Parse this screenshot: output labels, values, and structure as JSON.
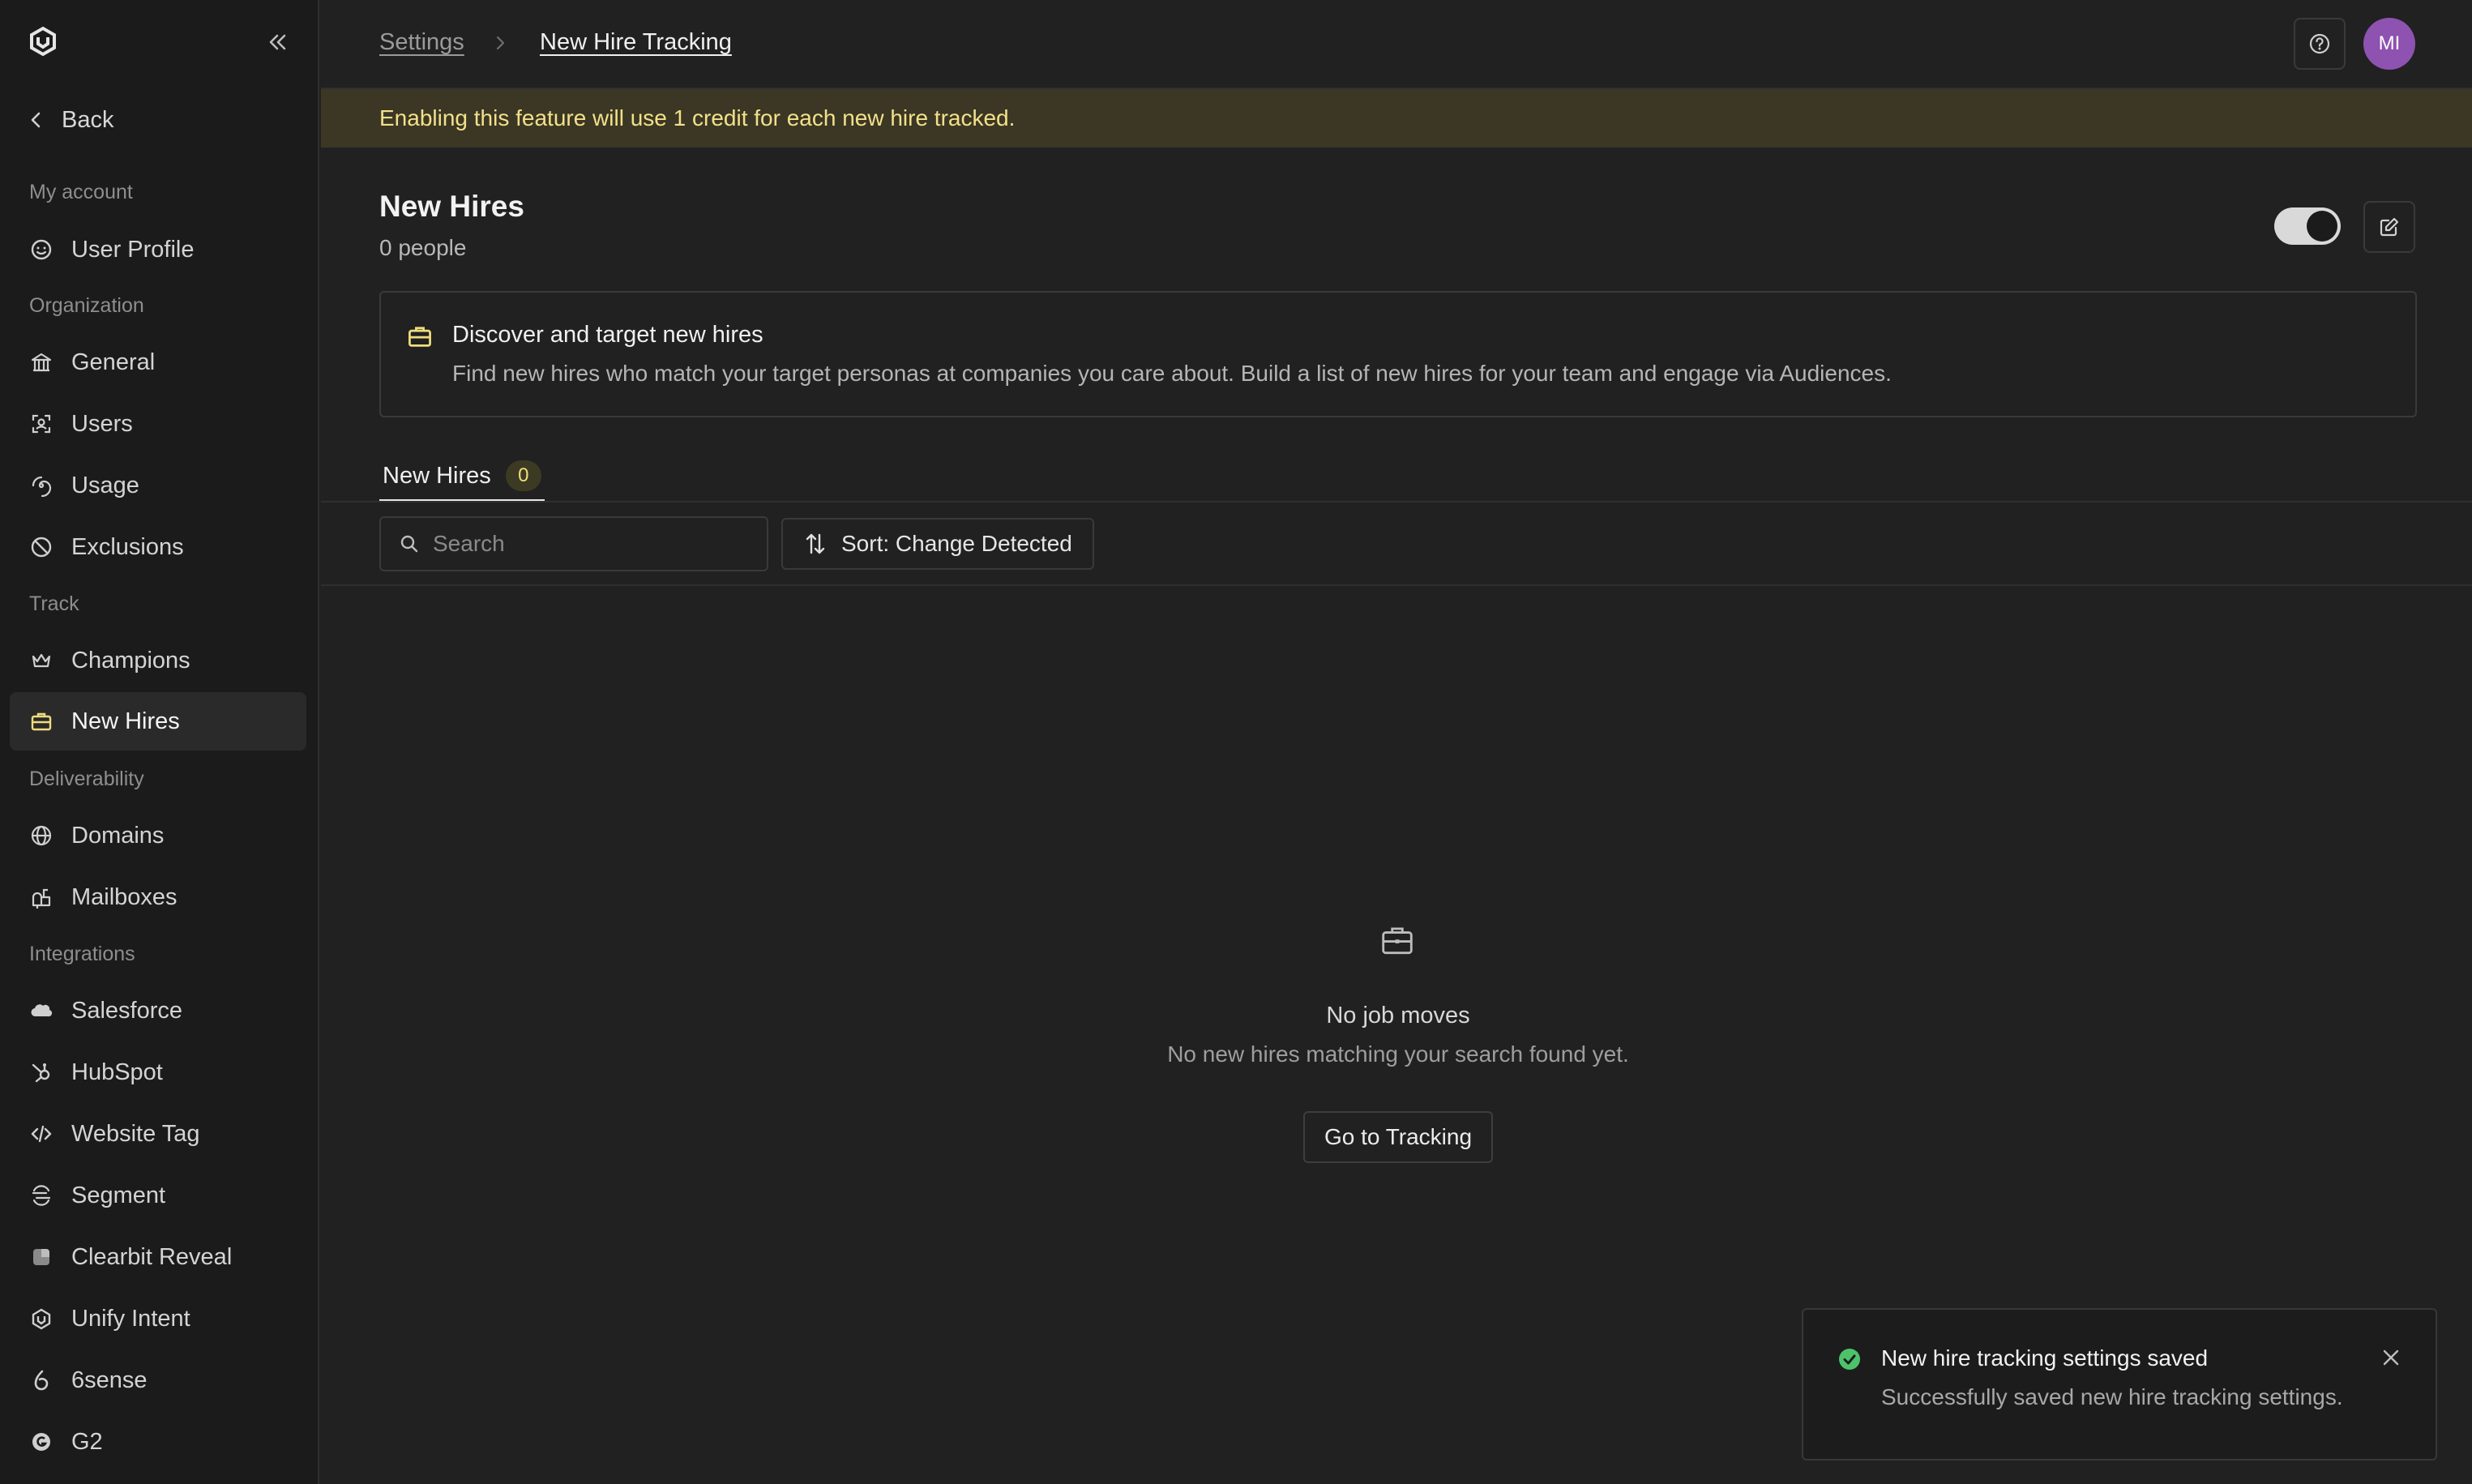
{
  "sidebar": {
    "back_label": "Back",
    "sections": {
      "my_account": "My account",
      "organization": "Organization",
      "track": "Track",
      "deliverability": "Deliverability",
      "integrations": "Integrations"
    },
    "items": {
      "user_profile": "User Profile",
      "general": "General",
      "users": "Users",
      "usage": "Usage",
      "exclusions": "Exclusions",
      "champions": "Champions",
      "new_hires": "New Hires",
      "domains": "Domains",
      "mailboxes": "Mailboxes",
      "salesforce": "Salesforce",
      "hubspot": "HubSpot",
      "website_tag": "Website Tag",
      "segment": "Segment",
      "clearbit_reveal": "Clearbit Reveal",
      "unify_intent": "Unify Intent",
      "sixsense": "6sense",
      "g2": "G2"
    },
    "active_item": "new_hires"
  },
  "topbar": {
    "breadcrumb": [
      "Settings",
      "New Hire Tracking"
    ],
    "avatar_initials": "MI",
    "avatar_color": "#8e52b0"
  },
  "banner": {
    "text": "Enabling this feature will use 1 credit for each new hire tracked.",
    "bg_color": "#3b3724",
    "text_color": "#f3e08a"
  },
  "header": {
    "title": "New Hires",
    "subtitle": "0 people",
    "toggle_enabled": true
  },
  "info_card": {
    "icon": "briefcase-icon",
    "title": "Discover and target new hires",
    "description": "Find new hires who match your target personas at companies you care about. Build a list of new hires for your team and engage via Audiences."
  },
  "tabs": [
    {
      "label": "New Hires",
      "count": "0",
      "active": true
    }
  ],
  "toolbar": {
    "search_placeholder": "Search",
    "sort_label": "Sort: Change Detected"
  },
  "empty_state": {
    "icon": "briefcase-icon",
    "title": "No job moves",
    "description": "No new hires matching your search found yet.",
    "button_label": "Go to Tracking"
  },
  "toast": {
    "title": "New hire tracking settings saved",
    "description": "Successfully saved new hire tracking settings.",
    "status_color": "#4cc36b"
  }
}
